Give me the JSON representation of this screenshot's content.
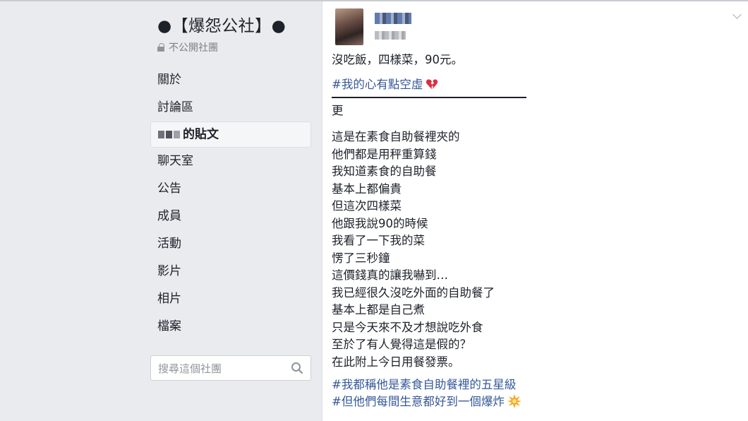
{
  "sidebar": {
    "group_title": "●【爆怨公社】●",
    "privacy_label": "不公開社團",
    "nav": [
      {
        "label": "關於"
      },
      {
        "label": "討論區"
      },
      {
        "label": "的貼文",
        "active": true
      },
      {
        "label": "聊天室"
      },
      {
        "label": "公告"
      },
      {
        "label": "成員"
      },
      {
        "label": "活動"
      },
      {
        "label": "影片"
      },
      {
        "label": "相片"
      },
      {
        "label": "檔案"
      }
    ],
    "search": {
      "placeholder": "搜尋這個社團",
      "icon": "search-icon"
    }
  },
  "post": {
    "first_line": "沒吃飯，四樣菜，90元。",
    "hashtag_1": "#我的心有點空虛",
    "hashtag_1_emoji": "broken-heart-icon",
    "update_label": "更",
    "body_lines": [
      "這是在素食自助餐裡夾的",
      "他們都是用秤重算錢",
      "我知道素食的自助餐",
      "基本上都偏貴",
      "但這次四樣菜",
      "他跟我說90的時候",
      "我看了一下我的菜",
      "愣了三秒鐘",
      "這價錢真的讓我嚇到…",
      "我已經很久沒吃外面的自助餐了",
      "基本上都是自己煮",
      "只是今天來不及才想說吃外食",
      "至於了有人覺得這是假的？",
      "在此附上今日用餐發票。"
    ],
    "hashtag_2": "#我都稱他是素食自助餐裡的五星級",
    "hashtag_3": "#但他們每間生意都好到一個爆炸",
    "hashtag_3_emoji": "explosion-icon"
  },
  "colors": {
    "background": "#e9ebee",
    "card": "#ffffff",
    "hashtag": "#365899",
    "text": "#1d2129"
  }
}
